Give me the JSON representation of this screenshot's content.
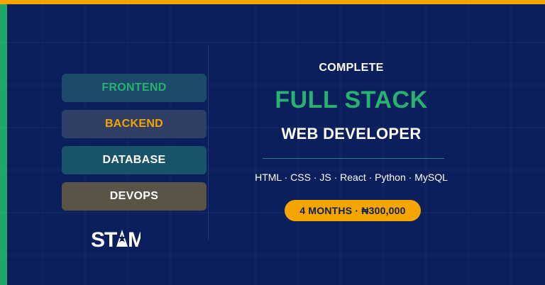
{
  "tracks": {
    "frontend": "FRONTEND",
    "backend": "BACKEND",
    "database": "DATABASE",
    "devops": "DEVOPS"
  },
  "brand": {
    "logo_text": "STAM"
  },
  "headline": {
    "kicker": "COMPLETE",
    "title": "FULL STACK",
    "subtitle": "WEB DEVELOPER"
  },
  "tech_stack": "HTML · CSS · JS · React · Python · MySQL",
  "offer": {
    "label": "4 MONTHS · ₦300,000"
  },
  "colors": {
    "background": "#0b1f5c",
    "accent_orange": "#f5a400",
    "accent_green": "#27b36f"
  }
}
